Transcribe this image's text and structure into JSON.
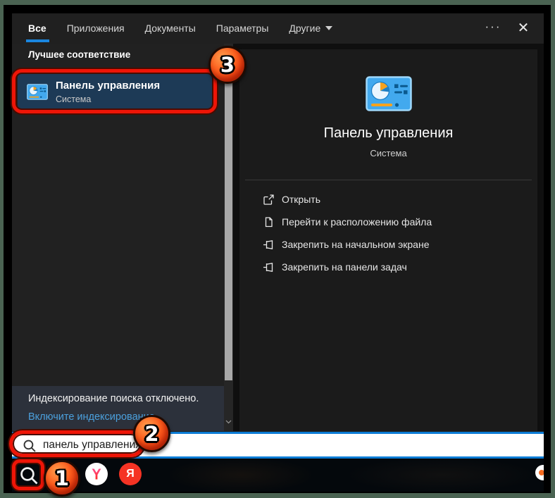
{
  "window": {
    "more_label": "···",
    "close_label": "✕"
  },
  "tabs": [
    {
      "label": "Все",
      "active": true
    },
    {
      "label": "Приложения",
      "active": false
    },
    {
      "label": "Документы",
      "active": false
    },
    {
      "label": "Параметры",
      "active": false
    },
    {
      "label": "Другие",
      "active": false
    }
  ],
  "left_panel": {
    "section_header": "Лучшее соответствие",
    "best_match": {
      "title": "Панель управления",
      "subtitle": "Система",
      "icon": "control-panel-icon"
    },
    "status": {
      "line1": "Индексирование поиска отключено.",
      "link": "Включите индексирование."
    }
  },
  "preview_panel": {
    "app_title": "Панель управления",
    "app_subtitle": "Система",
    "app_icon": "control-panel-icon",
    "actions": [
      {
        "label": "Открыть",
        "icon": "open-icon"
      },
      {
        "label": "Перейти к расположению файла",
        "icon": "file-location-icon"
      },
      {
        "label": "Закрепить на начальном экране",
        "icon": "pin-icon"
      },
      {
        "label": "Закрепить на панели задач",
        "icon": "pin-icon"
      }
    ]
  },
  "search_bar": {
    "value": "панель управления",
    "icon": "search-icon"
  },
  "taskbar": {
    "search_icon": "search-icon",
    "apps": [
      {
        "name": "yandex-browser",
        "letter": "Y"
      },
      {
        "name": "yandex",
        "letter": "Я"
      }
    ]
  },
  "annotations": {
    "step1": "1",
    "step2": "2",
    "step3": "3",
    "highlight_color": "#ee1507"
  },
  "colors": {
    "accent": "#0c7cd5",
    "selection": "#1d3a56",
    "link": "#4ba0dd",
    "tab_underline": "#1a86df"
  }
}
